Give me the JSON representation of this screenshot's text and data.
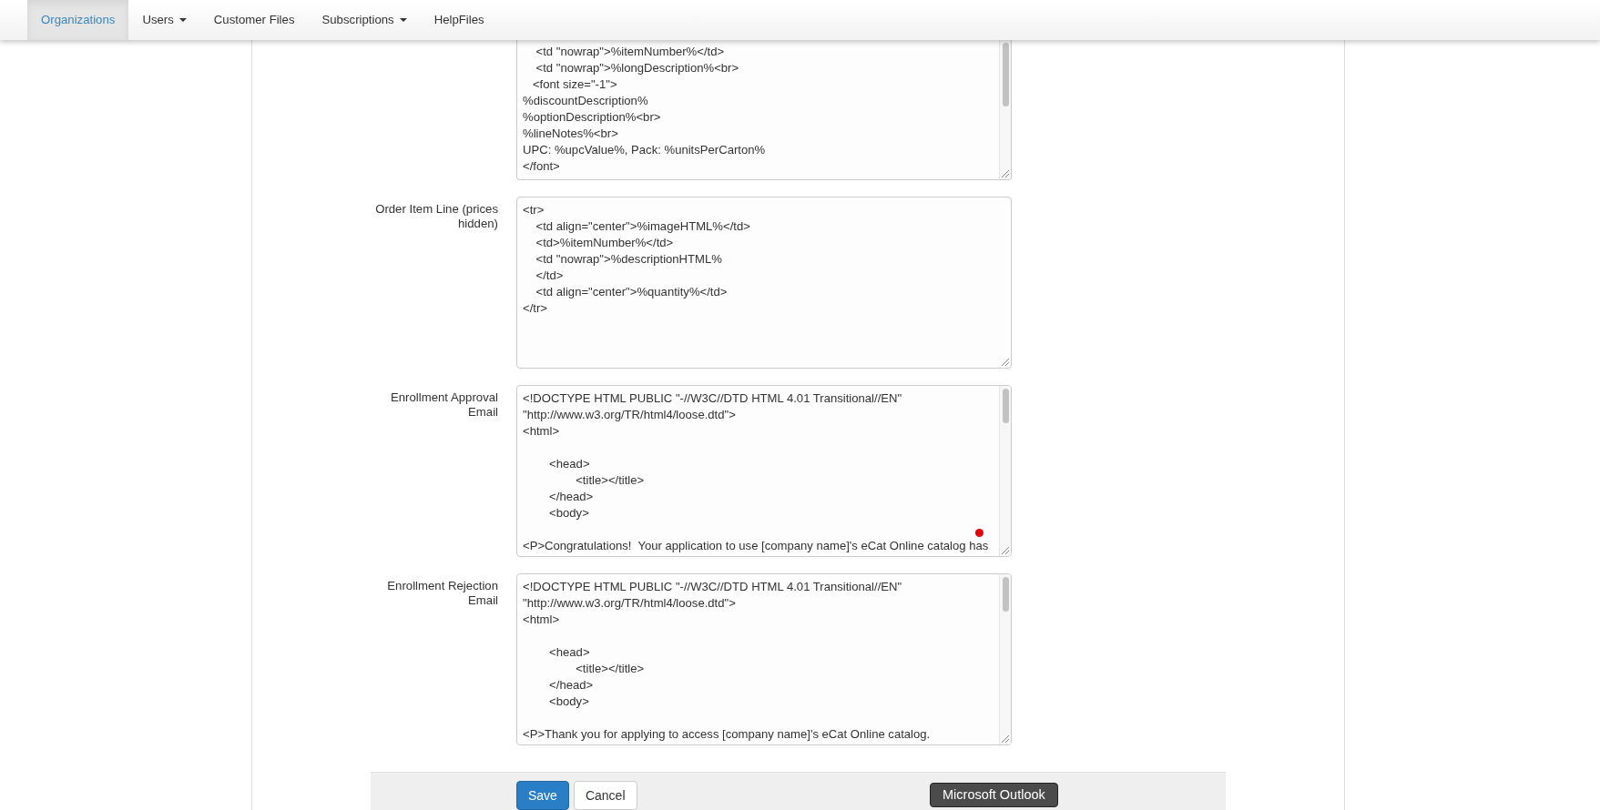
{
  "nav": {
    "tabs": [
      {
        "label": "Organizations",
        "selected": true,
        "dropdown": false
      },
      {
        "label": "Users",
        "selected": false,
        "dropdown": true
      },
      {
        "label": "Customer Files",
        "selected": false,
        "dropdown": false
      },
      {
        "label": "Subscriptions",
        "selected": false,
        "dropdown": true
      },
      {
        "label": "HelpFiles",
        "selected": false,
        "dropdown": false
      }
    ]
  },
  "fields": [
    {
      "value": "    <td \"nowrap\">%itemNumber%</td>\n    <td \"nowrap\">%longDescription%<br>\n   <font size=\"-1\">\n%discountDescription%\n%optionDescription%<br>\n%lineNotes%<br>\nUPC: %upcValue%, Pack: %unitsPerCarton%\n</font>",
      "scrollbar": true
    },
    {
      "label": "Order Item Line (prices hidden)",
      "value": "<tr>\n    <td align=\"center\">%imageHTML%</td>\n    <td>%itemNumber%</td>\n    <td \"nowrap\">%descriptionHTML%\n    </td>\n    <td align=\"center\">%quantity%</td>\n</tr>",
      "scrollbar": false
    },
    {
      "label": "Enrollment Approval Email",
      "value": "<!DOCTYPE HTML PUBLIC \"-//W3C//DTD HTML 4.01 Transitional//EN\"\n\"http://www.w3.org/TR/html4/loose.dtd\">\n<html>\n\n\t<head>\n\t\t<title></title>\n\t</head>\n\t<body>\n\n<P>Congratulations!  Your application to use [company name]'s eCat Online catalog has",
      "scrollbar": true,
      "pointer_dot": true
    },
    {
      "label": "Enrollment Rejection Email",
      "value": "<!DOCTYPE HTML PUBLIC \"-//W3C//DTD HTML 4.01 Transitional//EN\"\n\"http://www.w3.org/TR/html4/loose.dtd\">\n<html>\n\n\t<head>\n\t\t<title></title>\n\t</head>\n\t<body>\n\n<P>Thank you for applying to access [company name]'s eCat Online catalog.",
      "scrollbar": true
    }
  ],
  "buttons": [
    {
      "label": "Save",
      "kind": "primary"
    },
    {
      "label": "Cancel",
      "kind": "default"
    }
  ],
  "tooltip": "Microsoft Outlook"
}
